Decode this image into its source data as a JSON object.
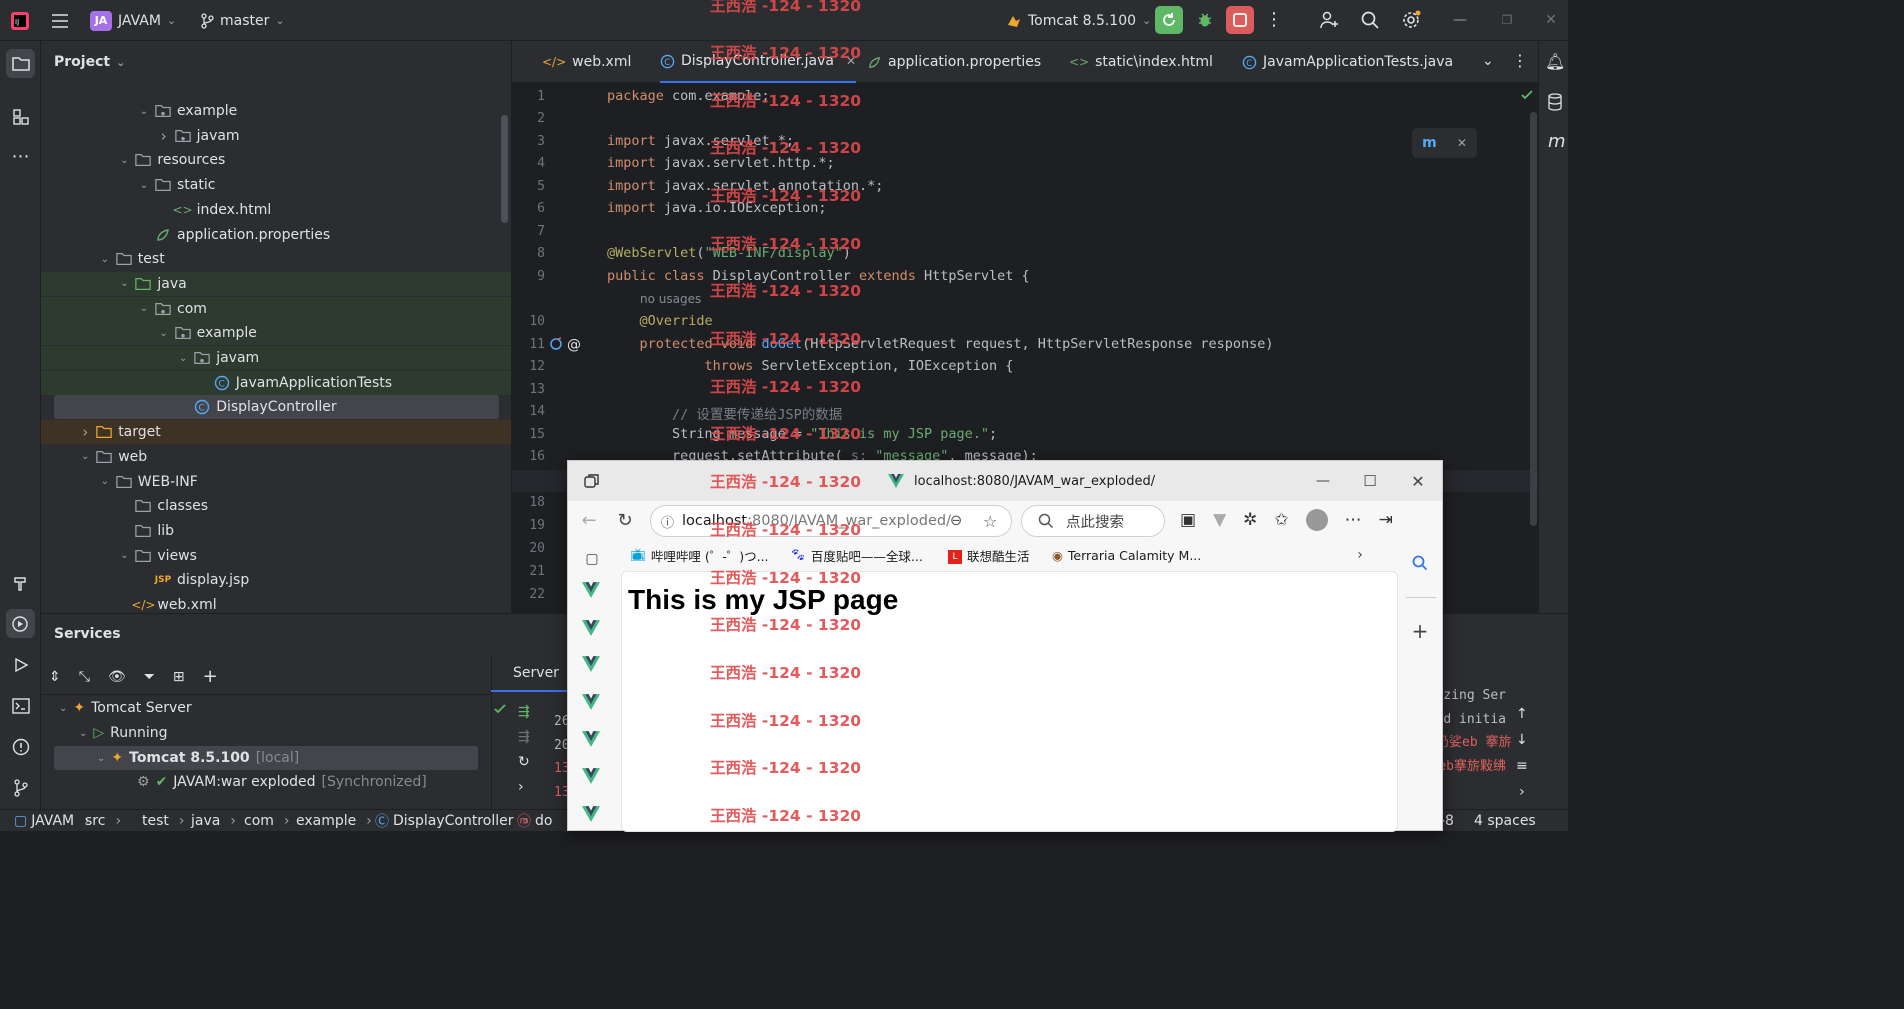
{
  "titlebar": {
    "project_badge": "JA",
    "project_name": "JAVAM",
    "branch": "master",
    "run_config": "Tomcat 8.5.100"
  },
  "project_panel": {
    "title": "Project",
    "tree": [
      {
        "label": "example",
        "type": "pkg",
        "depth": 5,
        "chev": "down"
      },
      {
        "label": "javam",
        "type": "pkg",
        "depth": 6,
        "chev": "right"
      },
      {
        "label": "resources",
        "type": "res",
        "depth": 4,
        "chev": "down"
      },
      {
        "label": "static",
        "type": "folder",
        "depth": 5,
        "chev": "down"
      },
      {
        "label": "index.html",
        "type": "html",
        "depth": 6,
        "chev": ""
      },
      {
        "label": "application.properties",
        "type": "props",
        "depth": 5,
        "chev": ""
      },
      {
        "label": "test",
        "type": "folder",
        "depth": 3,
        "chev": "down"
      },
      {
        "label": "java",
        "type": "testfolder",
        "depth": 4,
        "chev": "down",
        "hl": "green"
      },
      {
        "label": "com",
        "type": "pkg",
        "depth": 5,
        "chev": "down",
        "hl": "green"
      },
      {
        "label": "example",
        "type": "pkg",
        "depth": 6,
        "chev": "down",
        "hl": "green"
      },
      {
        "label": "javam",
        "type": "pkg",
        "depth": 7,
        "chev": "down",
        "hl": "green"
      },
      {
        "label": "JavamApplicationTests",
        "type": "class",
        "depth": 8,
        "chev": "",
        "hl": "green"
      },
      {
        "label": "DisplayController",
        "type": "class",
        "depth": 7,
        "chev": "",
        "hl": "selected"
      },
      {
        "label": "target",
        "type": "orange",
        "depth": 2,
        "chev": "right",
        "hl": "orange"
      },
      {
        "label": "web",
        "type": "web",
        "depth": 2,
        "chev": "down"
      },
      {
        "label": "WEB-INF",
        "type": "folder",
        "depth": 3,
        "chev": "down"
      },
      {
        "label": "classes",
        "type": "folder",
        "depth": 4,
        "chev": ""
      },
      {
        "label": "lib",
        "type": "folder",
        "depth": 4,
        "chev": ""
      },
      {
        "label": "views",
        "type": "folder",
        "depth": 4,
        "chev": "down"
      },
      {
        "label": "display.jsp",
        "type": "jsp",
        "depth": 5,
        "chev": ""
      },
      {
        "label": "web.xml",
        "type": "xml",
        "depth": 4,
        "chev": ""
      }
    ]
  },
  "editor": {
    "tabs": [
      {
        "label": "web.xml",
        "icon": "xml-icon"
      },
      {
        "label": "DisplayController.java",
        "icon": "class-icon",
        "active": true
      },
      {
        "label": "application.properties",
        "icon": "props-icon"
      },
      {
        "label": "static\\index.html",
        "icon": "html-icon"
      },
      {
        "label": "JavamApplicationTests.java",
        "icon": "class-icon"
      }
    ],
    "line_numbers": [
      "1",
      "2",
      "3",
      "4",
      "5",
      "6",
      "7",
      "8",
      "9",
      "10",
      "11",
      "12",
      "13",
      "14",
      "15",
      "16",
      "17",
      "18",
      "19",
      "20",
      "21",
      "22"
    ],
    "hint_no_usages": "no usages",
    "lines": [
      "<span class='kw'>package</span> com.example;",
      "",
      "<span class='kw'>import</span> javax.servlet.*;",
      "<span class='kw'>import</span> javax.servlet.http.*;",
      "<span class='kw'>import</span> javax.servlet.annotation.*;",
      "<span class='kw'>import</span> java.io.IOException;",
      "",
      "<span class='an'>@WebServlet</span>(<span class='st'>\"WEB-INF/display\"</span>)",
      "<span class='kw'>public class</span> DisplayController <span class='kw'>extends</span> HttpServlet {",
      "    <span class='an'>@Override</span>",
      "    <span class='kw'>protected void</span> <span class='fn'>doGet</span>(HttpServletRequest request, HttpServletResponse response)",
      "            <span class='kw'>throws</span> ServletException, IOException {",
      "",
      "        <span class='cm'>// 设置要传递给JSP的数据</span>",
      "        String message = <span class='st'>\"This is my JSP page.\"</span>;",
      "        request.setAttribute( <span class='cm'>s:</span> <span class='st'>\"message\"</span>, message);"
    ]
  },
  "services": {
    "title": "Services",
    "tab_server": "Server",
    "tomcat_server": "Tomcat Server",
    "running": "Running",
    "tomcat_instance": "Tomcat 8.5.100",
    "tomcat_tag": "[local]",
    "artifact": "JAVAM:war exploded",
    "artifact_tag": "[Synchronized]",
    "log_left": [
      "26",
      "20",
      "13",
      "13"
    ],
    "log_right": [
      "zing Ser",
      "d initia",
      "扔娑eb 搴旂",
      "eb搴旂敤绋"
    ]
  },
  "statusbar": {
    "crumbs": [
      "JAVAM",
      "src",
      "test",
      "java",
      "com",
      "example",
      "DisplayController",
      "do"
    ],
    "encoding_tail": "-8",
    "indent": "4 spaces"
  },
  "browser": {
    "tab_title": "localhost:8080/JAVAM_war_exploded/",
    "url_host": "localhost",
    "url_path": ":8080/JAVAM_war_exploded/",
    "search_placeholder": "点此搜索",
    "favorites": [
      {
        "label": "哔哩哔哩 (゜-゜)つ...",
        "icon": "bilibili-icon"
      },
      {
        "label": "百度贴吧——全球...",
        "icon": "baidu-icon"
      },
      {
        "label": "联想酷生活",
        "icon": "lenovo-icon"
      },
      {
        "label": "Terraria Calamity M...",
        "icon": "terraria-icon"
      }
    ],
    "page_heading": "This is my JSP page"
  },
  "watermark": "王西浩 -124 - 1320",
  "colors": {
    "accent": "#3574f0",
    "run_green": "#5fb865",
    "stop_red": "#db5c5c",
    "watermark_red": "#e04a4a"
  }
}
